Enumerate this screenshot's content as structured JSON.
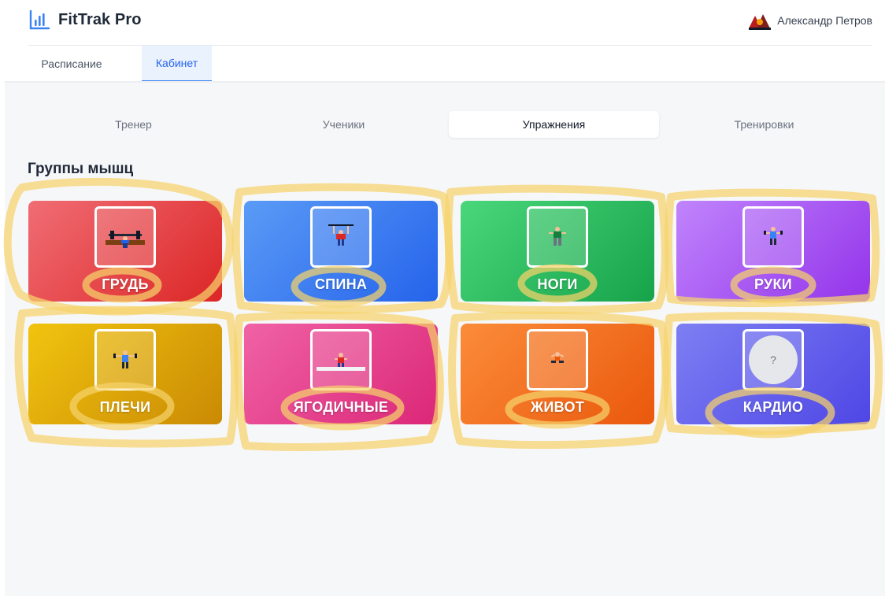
{
  "app": {
    "name": "FitTrak Pro",
    "icon": "bar-chart-icon"
  },
  "user": {
    "name": "Александр Петров",
    "avatar": "user-avatar"
  },
  "tabs": [
    {
      "label": "Расписание",
      "active": false
    },
    {
      "label": "Кабинет",
      "active": true
    }
  ],
  "subtabs": [
    {
      "label": "Тренер",
      "active": false
    },
    {
      "label": "Ученики",
      "active": false
    },
    {
      "label": "Упражнения",
      "active": true
    },
    {
      "label": "Тренировки",
      "active": false
    }
  ],
  "section_title": "Группы мышц",
  "groups": [
    {
      "label": "ГРУДЬ",
      "color": "#dc2626",
      "icon": "bench-press-icon"
    },
    {
      "label": "СПИНА",
      "color": "#2563eb",
      "icon": "pull-up-icon"
    },
    {
      "label": "НОГИ",
      "color": "#16a34a",
      "icon": "squat-icon"
    },
    {
      "label": "РУКИ",
      "color": "#9333ea",
      "icon": "biceps-curl-icon"
    },
    {
      "label": "ПЛЕЧИ",
      "color": "#ca8a04",
      "icon": "shoulder-press-icon"
    },
    {
      "label": "ЯГОДИЧНЫЕ",
      "color": "#db2777",
      "icon": "glute-bridge-icon"
    },
    {
      "label": "ЖИВОТ",
      "color": "#ea580c",
      "icon": "crunch-icon"
    },
    {
      "label": "КАРДИО",
      "color": "#4f46e5",
      "icon": "placeholder-icon",
      "placeholder": "?"
    }
  ],
  "annotation_color": "#f5d36b"
}
